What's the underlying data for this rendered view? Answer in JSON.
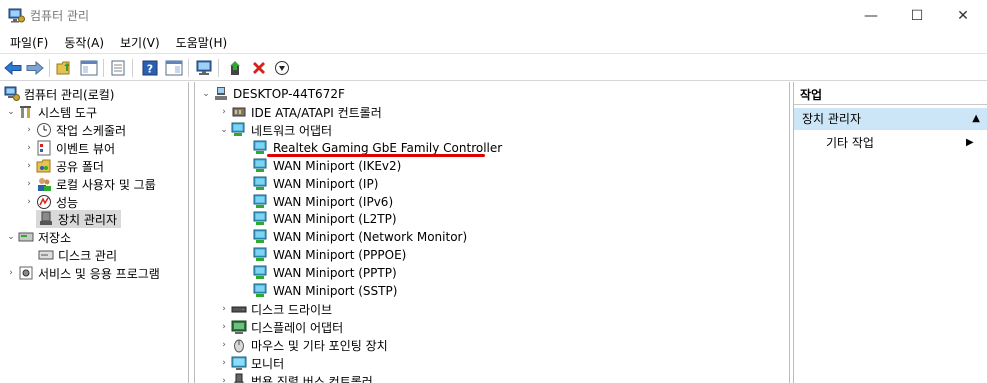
{
  "window": {
    "title": "컴퓨터 관리",
    "controls": {
      "minimize": "—",
      "maximize": "☐",
      "close": "✕"
    }
  },
  "menu": [
    "파일(F)",
    "동작(A)",
    "보기(V)",
    "도움말(H)"
  ],
  "left_tree": {
    "root": "컴퓨터 관리(로컬)",
    "system_tools": "시스템 도구",
    "task_scheduler": "작업 스케줄러",
    "event_viewer": "이벤트 뷰어",
    "shared_folders": "공유 폴더",
    "local_users": "로컬 사용자 및 그룹",
    "performance": "성능",
    "device_manager": "장치 관리자",
    "storage": "저장소",
    "disk_management": "디스크 관리",
    "services": "서비스 및 응용 프로그램"
  },
  "device_tree": {
    "computer": "DESKTOP-44T672F",
    "ide": "IDE ATA/ATAPI 컨트롤러",
    "network_adapters": "네트워크 어댑터",
    "adapters": [
      "Realtek Gaming GbE Family Controller",
      "WAN Miniport (IKEv2)",
      "WAN Miniport (IP)",
      "WAN Miniport (IPv6)",
      "WAN Miniport (L2TP)",
      "WAN Miniport (Network Monitor)",
      "WAN Miniport (PPPOE)",
      "WAN Miniport (PPTP)",
      "WAN Miniport (SSTP)"
    ],
    "disk_drives": "디스크 드라이브",
    "display_adapters": "디스플레이 어댑터",
    "mice": "마우스 및 기타 포인팅 장치",
    "monitors": "모니터",
    "usb": "범용 직렬 버스 컨트롤러"
  },
  "actions": {
    "header": "작업",
    "section": "장치 관리자",
    "more": "기타 작업"
  }
}
